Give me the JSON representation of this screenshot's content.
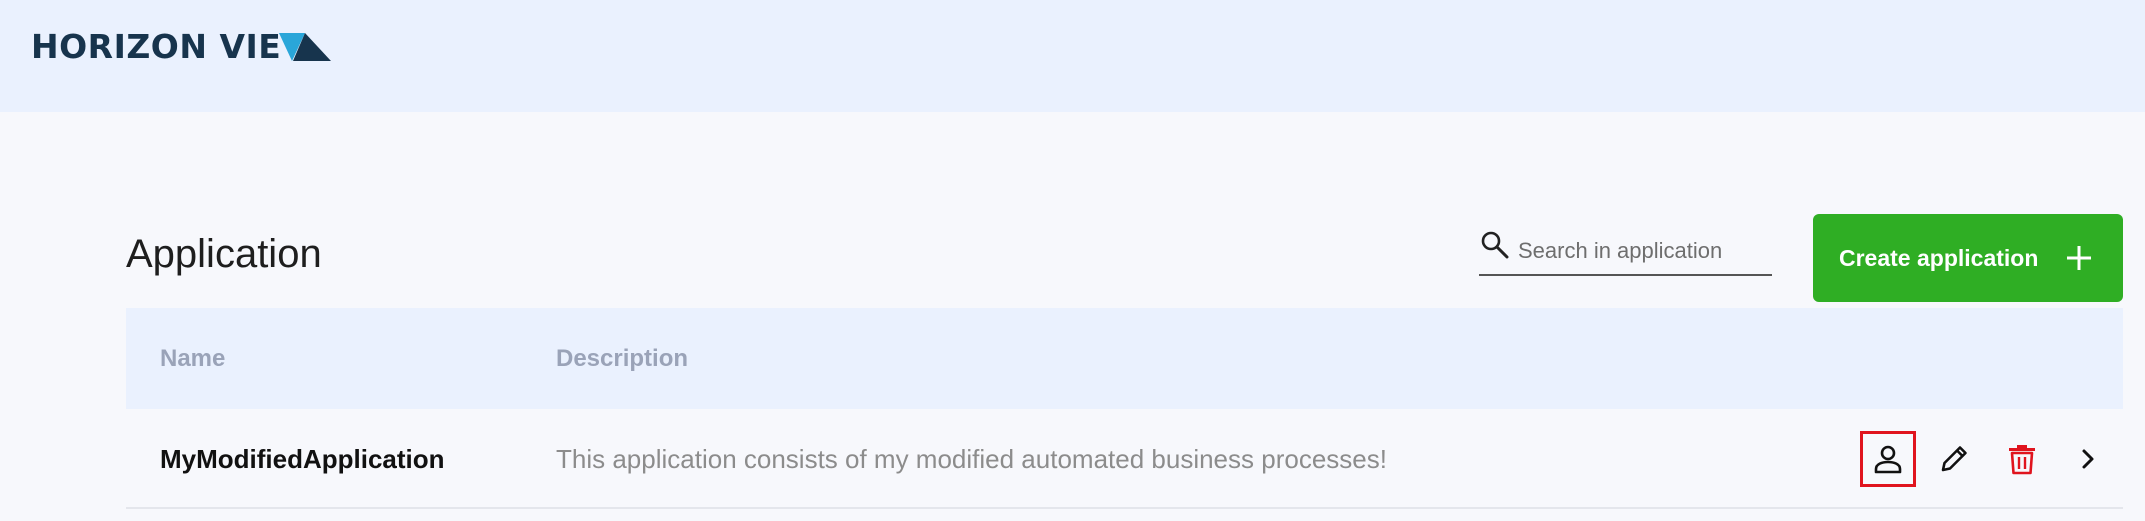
{
  "header": {
    "logo_text": "HORIZON VIE"
  },
  "main": {
    "title": "Application",
    "search": {
      "placeholder": "Search in application",
      "value": ""
    },
    "create_button_label": "Create application",
    "table": {
      "columns": [
        "Name",
        "Description"
      ],
      "rows": [
        {
          "name": "MyModifiedApplication",
          "description": "This application consists of my modified automated business processes!",
          "actions": [
            "user-icon",
            "pencil-icon",
            "trash-icon",
            "chevron-right-icon"
          ]
        }
      ]
    }
  },
  "colors": {
    "header_bg": "#eaf1fe",
    "page_bg": "#f7f8fc",
    "brand_dark": "#17344d",
    "brand_light": "#2aa6d9",
    "create_button": "#2fae24",
    "delete_icon": "#e0141e",
    "highlight": "#e0141e"
  }
}
